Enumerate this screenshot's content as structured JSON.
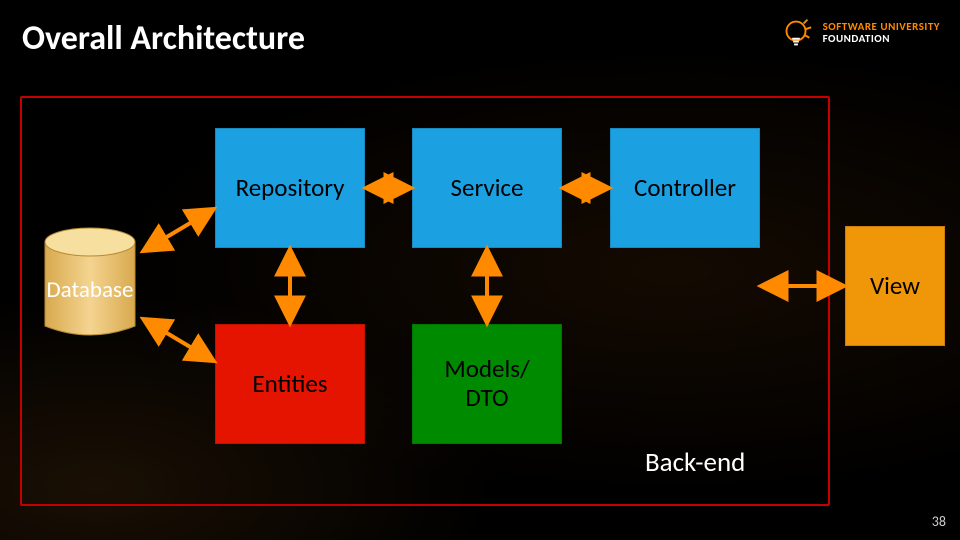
{
  "title": "Overall Architecture",
  "logo": {
    "line1": "SOFTWARE UNIVERSITY",
    "line2": "FOUNDATION"
  },
  "slide_number": "38",
  "labels": {
    "database": "Database",
    "repository": "Repository",
    "service": "Service",
    "controller": "Controller",
    "entities": "Entities",
    "models_dto": "Models/\nDTO",
    "view": "View",
    "backend": "Back-end"
  },
  "colors": {
    "blue": "#1ba1e2",
    "red": "#e51400",
    "green": "#008a00",
    "orange": "#f09609",
    "db_fill": "#f0c775",
    "frame": "#c40000"
  }
}
